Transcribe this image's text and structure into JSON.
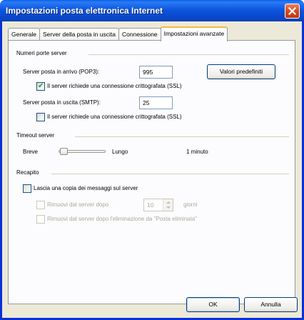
{
  "window": {
    "title": "Impostazioni posta elettronica Internet"
  },
  "tabs": [
    {
      "label": "Generale"
    },
    {
      "label": "Server della posta in uscita"
    },
    {
      "label": "Connessione"
    },
    {
      "label": "Impostazioni avanzate",
      "active": true
    }
  ],
  "ports": {
    "heading": "Numeri porte server",
    "incoming_label": "Server posta in arrivo (POP3):",
    "incoming_value": "995",
    "defaults_button": "Valori predefiniti",
    "incoming_ssl_label": "Il server richiede una connessione crittografata (SSL)",
    "incoming_ssl_checked": true,
    "outgoing_label": "Server posta in uscita (SMTP):",
    "outgoing_value": "25",
    "outgoing_ssl_label": "Il server richiede una connessione crittografata (SSL)",
    "outgoing_ssl_checked": false
  },
  "timeout": {
    "heading": "Timeout server",
    "short_label": "Breve",
    "long_label": "Lungo",
    "value_text": "1 minuto"
  },
  "delivery": {
    "heading": "Recapito",
    "leave_copy_label": "Lascia una copia dei messaggi sul server",
    "leave_copy_checked": false,
    "remove_after_label": "Rimuovi dal server dopo",
    "remove_after_days": "10",
    "days_label": "giorni",
    "remove_deleted_label": "Rimuovi dal server dopo l'eliminazione da \"Posta eliminata\""
  },
  "footer": {
    "ok_label": "OK",
    "cancel_label": "Annulla"
  },
  "colors": {
    "titlebar": "#0a55dc",
    "dialog_bg": "#ece9d8",
    "active_tab_accent": "#f9b841",
    "check_mark": "#21a121"
  },
  "icons": {
    "close": "close-icon",
    "check": "check-icon",
    "spin_up": "spin-up-icon",
    "spin_down": "spin-down-icon"
  }
}
